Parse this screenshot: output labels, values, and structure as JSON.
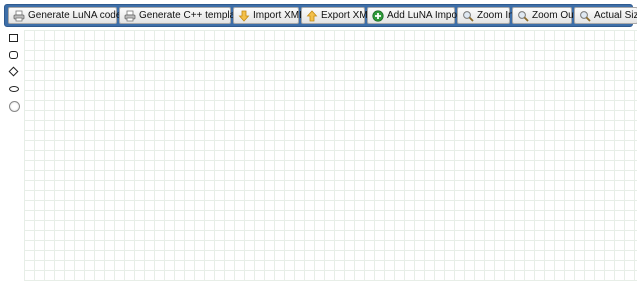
{
  "toolbar": {
    "buttons": [
      {
        "id": "generate-luna-code",
        "label": "Generate LuNA code",
        "icon": "printer-icon"
      },
      {
        "id": "generate-cpp-template",
        "label": "Generate C++ template",
        "icon": "printer-icon"
      },
      {
        "id": "import-xml",
        "label": "Import XML",
        "icon": "arrow-down-icon"
      },
      {
        "id": "export-xml",
        "label": "Export XML",
        "icon": "arrow-up-icon"
      },
      {
        "id": "add-luna-import",
        "label": "Add LuNA Import",
        "icon": "add-icon"
      },
      {
        "id": "zoom-in",
        "label": "Zoom In",
        "icon": "magnifier-icon"
      },
      {
        "id": "zoom-out",
        "label": "Zoom Out",
        "icon": "magnifier-icon"
      },
      {
        "id": "actual-size",
        "label": "Actual Size",
        "icon": "magnifier-icon"
      }
    ]
  },
  "palette": {
    "shapes": [
      "rectangle",
      "rounded-rectangle",
      "diamond",
      "ellipse",
      "circle"
    ]
  },
  "colors": {
    "toolbar_bg": "#3d6ea8",
    "grid_line": "#e7eee7",
    "add_icon": "#2f9a3a",
    "arrow_icon": "#e6a817"
  }
}
